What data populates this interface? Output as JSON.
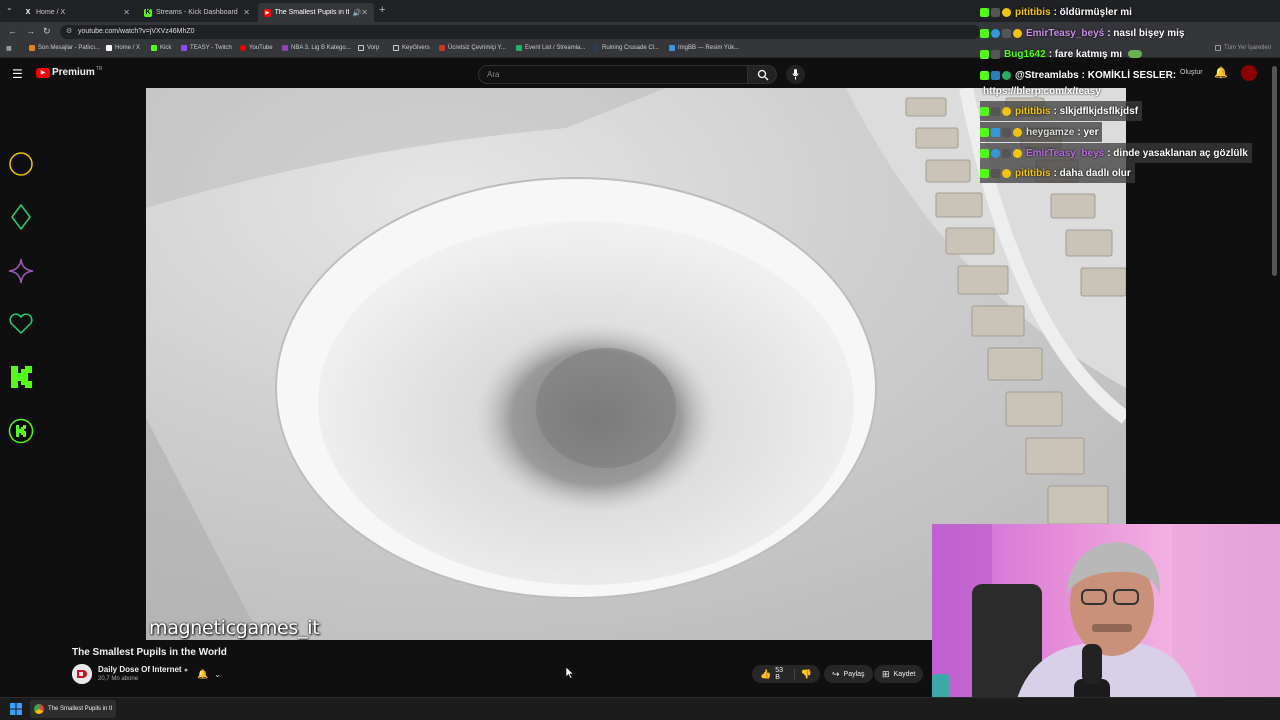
{
  "browser": {
    "tabs": [
      {
        "title": "Home / X",
        "icon": "x-logo-icon"
      },
      {
        "title": "Streams - Kick Dashboard",
        "icon": "kick-logo-icon"
      },
      {
        "title": "The Smallest Pupils in the W",
        "icon": "youtube-logo-icon",
        "active": true
      }
    ],
    "url": "youtube.com/watch?v=jVXVz46MhZ0",
    "bookmarks": [
      "Son Mesajlar - Patlıcı...",
      "Home / X",
      "Kick",
      "TEASY - Twitch",
      "YouTube",
      "NBA 3. Lig B Katego...",
      "Vorp",
      "KeyGivers",
      "Ücretsiz Çevrimiçi Y...",
      "Event List / Streamla...",
      "Ruining Crusade Cl...",
      "ImgBB — Resim Yük..."
    ],
    "all_bookmarks_label": "Tüm Yer İşaretleri"
  },
  "youtube": {
    "logo_label": "Premium",
    "logo_region": "TR",
    "search_placeholder": "Ara",
    "create_label": "Oluştur"
  },
  "video": {
    "watermark": "magneticgames_it",
    "title": "The Smallest Pupils in the World",
    "channel": "Daily Dose Of Internet",
    "subscribers": "20,7 Mn abone",
    "likes": "53 B",
    "share_label": "Paylaş",
    "save_label": "Kaydet"
  },
  "chat": {
    "messages": [
      {
        "user": "pititibis",
        "text": ": öldürmüşler mi",
        "color": "#f1c40f",
        "dim": false
      },
      {
        "user": "EmirTeasy_beyś",
        "text": ": nasıl bişey miş",
        "color": "#c98ce8",
        "dim": false
      },
      {
        "user": "Bug1642",
        "text": ": fare katmış mı",
        "color": "#53fc18",
        "dim": false
      },
      {
        "user": "@Streamlabs",
        "text": ": KOMİKLİ SESLER:",
        "color": "#ffffff",
        "dim": false
      },
      {
        "user": "",
        "text": "https://blerp.com/x/teasy",
        "color": "#ffffff",
        "dim": false
      },
      {
        "user": "pititibis",
        "text": ": slkjdflkjdsflkjdsf",
        "color": "#f1c40f",
        "dim": true
      },
      {
        "user": "heygamze",
        "text": ": yer",
        "color": "#dddddd",
        "dim": true
      },
      {
        "user": "EmirTeasy_beyś",
        "text": ": dinde yasaklanan aç gözlülk",
        "color": "#b86ae0",
        "dim": true
      },
      {
        "user": "pititibis",
        "text": ": daha dadlı olur",
        "color": "#f1c40f",
        "dim": true
      }
    ]
  },
  "taskbar": {
    "app_title": "The Smallest Pupils in tl"
  },
  "colors": {
    "kick_green": "#53fc18",
    "yt_red": "#ff0000",
    "bg": "#0f0f0f"
  }
}
